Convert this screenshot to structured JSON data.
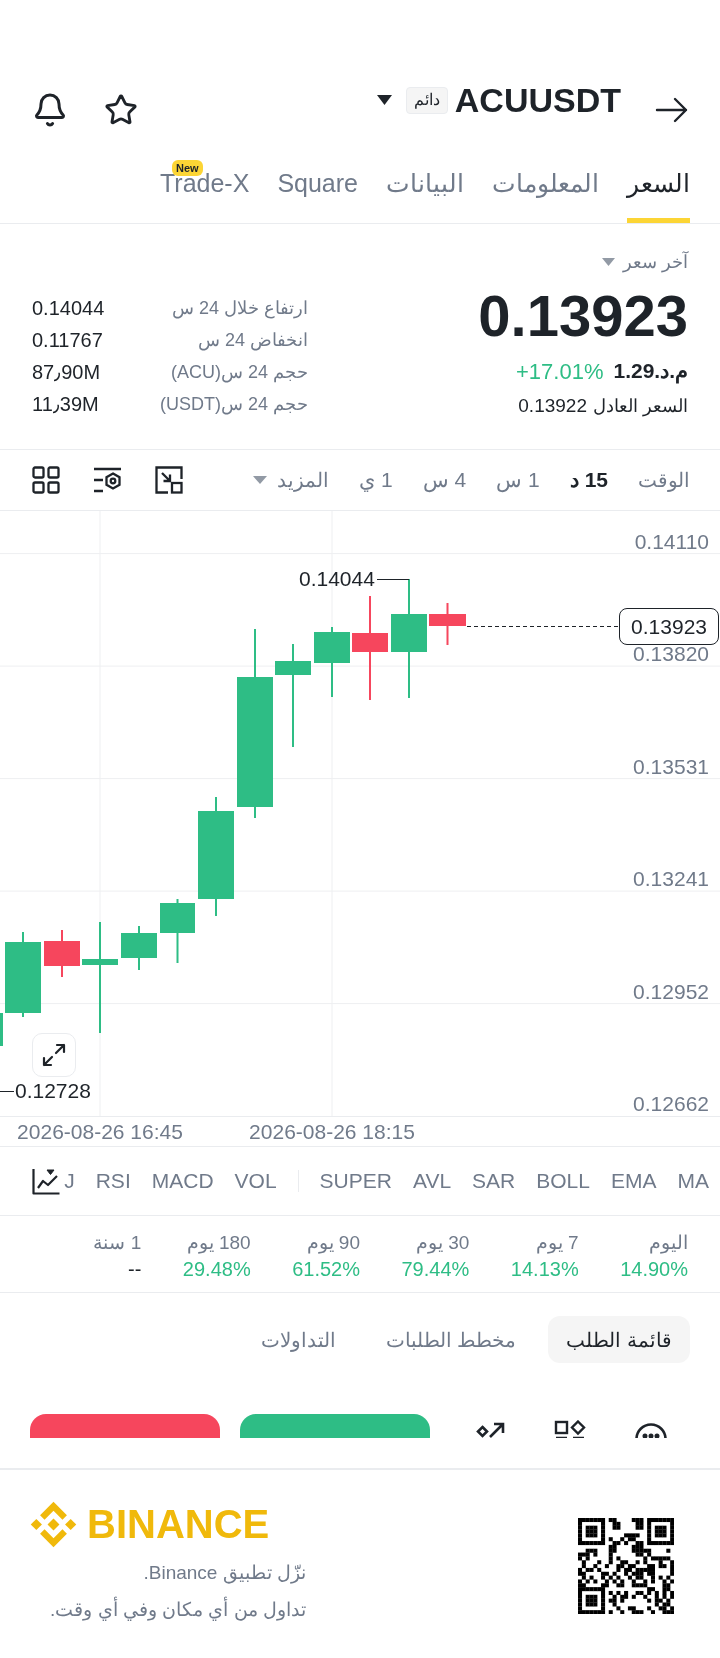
{
  "header": {
    "symbol": "ACUUSDT",
    "badge": "دائم"
  },
  "tabs": [
    {
      "label": "السعر",
      "selected": true
    },
    {
      "label": "المعلومات",
      "selected": false
    },
    {
      "label": "البيانات",
      "selected": false
    },
    {
      "label": "Square",
      "selected": false
    },
    {
      "label": "Trade-X",
      "selected": false,
      "badge": "New"
    }
  ],
  "price": {
    "label": "آخر سعر",
    "last": "0.13923",
    "fiat": "م.د.1.29",
    "change": "+17.01%",
    "fair_label": "السعر العادل",
    "fair": "0.13922"
  },
  "stats": [
    {
      "label": "ارتفاع خلال 24 س",
      "value": "0.14044"
    },
    {
      "label": "انخفاض 24 س",
      "value": "0.11767"
    },
    {
      "label": "حجم 24 س(ACU)",
      "value": "87٫90M"
    },
    {
      "label": "حجم 24 س(USDT)",
      "value": "11٫39M"
    }
  ],
  "toolbar": {
    "label": "الوقت",
    "intervals": [
      {
        "label": "15 د",
        "selected": true
      },
      {
        "label": "1 س",
        "selected": false
      },
      {
        "label": "4 س",
        "selected": false
      },
      {
        "label": "1 ي",
        "selected": false
      }
    ],
    "more": "المزيد"
  },
  "chart": {
    "price_ticks": [
      "0.14110",
      "0.13820",
      "0.13531",
      "0.13241",
      "0.12952",
      "0.12662"
    ],
    "time_labels": [
      "2026-08-26 18:15",
      "2026-08-26 16:45"
    ],
    "high_label": "0.14044",
    "low_label": "0.12728",
    "last_price": "0.13923"
  },
  "indicators": {
    "main": [
      "MA",
      "EMA",
      "BOLL",
      "SAR",
      "AVL",
      "SUPER"
    ],
    "sub": [
      "VOL",
      "MACD",
      "RSI",
      "J"
    ]
  },
  "performance": [
    {
      "period": "اليوم",
      "value": "14.90%",
      "color": "#2ebd85"
    },
    {
      "period": "7 يوم",
      "value": "14.13%",
      "color": "#2ebd85"
    },
    {
      "period": "30 يوم",
      "value": "79.44%",
      "color": "#2ebd85"
    },
    {
      "period": "90 يوم",
      "value": "61.52%",
      "color": "#2ebd85"
    },
    {
      "period": "180 يوم",
      "value": "29.48%",
      "color": "#2ebd85"
    },
    {
      "period": "1 سنة",
      "value": "--",
      "color": "#1e2329"
    }
  ],
  "book_tabs": [
    {
      "label": "قائمة الطلب",
      "selected": true
    },
    {
      "label": "مخطط الطلبات",
      "selected": false
    },
    {
      "label": "التداولات",
      "selected": false
    }
  ],
  "footer": {
    "brand": "BINANCE",
    "lines": [
      "نزّل تطبيق Binance.",
      "تداول من أي مكان وفي أي وقت."
    ]
  }
}
